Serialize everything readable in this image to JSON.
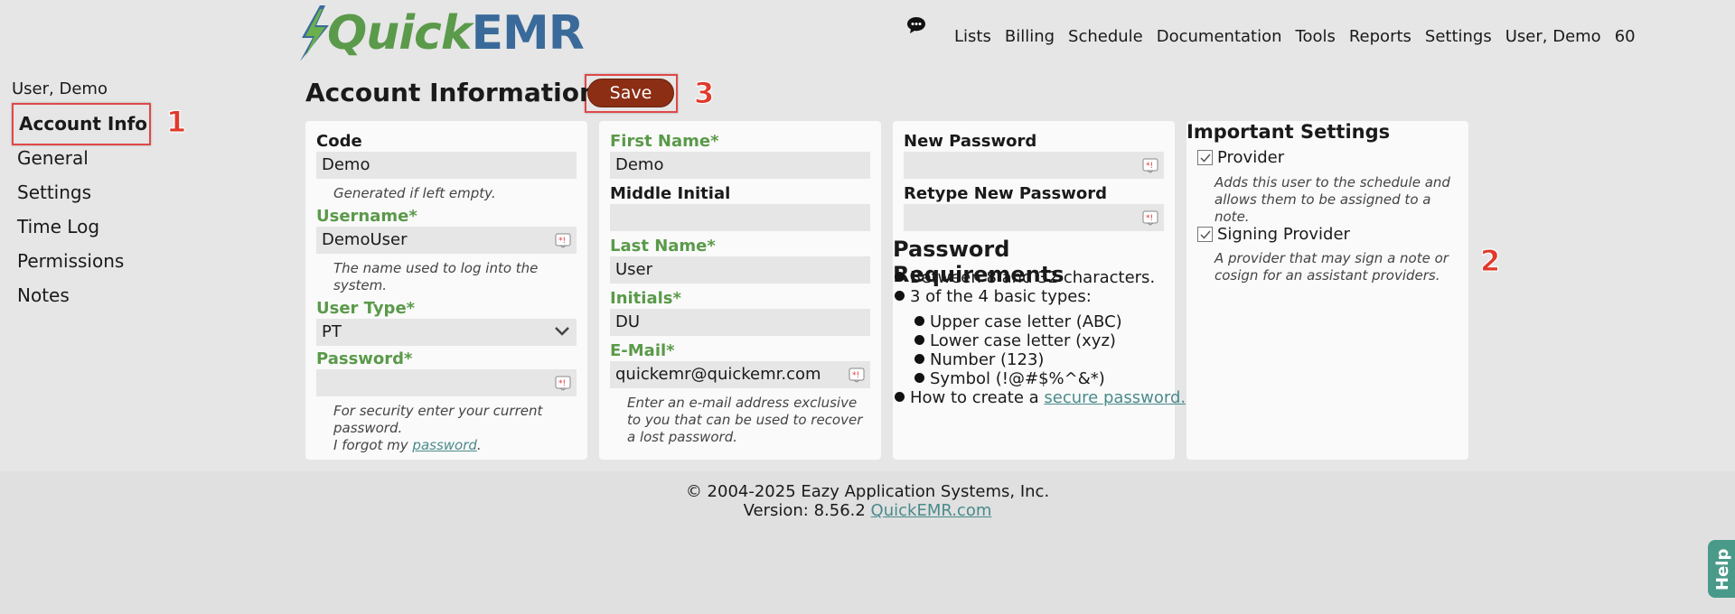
{
  "header": {
    "logo": {
      "quick": "Quick",
      "emr": "EMR"
    },
    "nav": [
      "Lists",
      "Billing",
      "Schedule",
      "Documentation",
      "Tools",
      "Reports",
      "Settings",
      "User, Demo",
      "60"
    ]
  },
  "sidebar": {
    "user": "User, Demo",
    "items": [
      {
        "label": "Account Info",
        "active": true
      },
      {
        "label": "General"
      },
      {
        "label": "Settings"
      },
      {
        "label": "Time Log"
      },
      {
        "label": "Permissions"
      },
      {
        "label": "Notes"
      }
    ]
  },
  "annotations": [
    "1",
    "2",
    "3"
  ],
  "page": {
    "title": "Account Information",
    "save_label": "Save"
  },
  "col1": {
    "code_label": "Code",
    "code_value": "Demo",
    "code_hint": "Generated if left empty.",
    "username_label": "Username*",
    "username_value": "DemoUser",
    "username_hint": "The name used to log into the system.",
    "usertype_label": "User Type*",
    "usertype_value": "PT",
    "password_label": "Password*",
    "password_hint": "For security enter your current password.",
    "forgot_prefix": "I forgot my ",
    "forgot_link": "password",
    "forgot_suffix": "."
  },
  "col2": {
    "first_label": "First Name*",
    "first_value": "Demo",
    "middle_label": "Middle Initial",
    "middle_value": "",
    "last_label": "Last Name*",
    "last_value": "User",
    "initials_label": "Initials*",
    "initials_value": "DU",
    "email_label": "E-Mail*",
    "email_value": "quickemr@quickemr.com",
    "email_hint": "Enter an e-mail address exclusive to you that can be used to recover a lost password."
  },
  "col3": {
    "newpw_label": "New Password",
    "retype_label": "Retype New Password",
    "req_title": "Password Requirements",
    "req_1": "Between 8 and 32 characters.",
    "req_2": "3 of the 4 basic types:",
    "types": [
      "Upper case letter (ABC)",
      "Lower case letter (xyz)",
      "Number (123)",
      "Symbol (!@#$%^&*)"
    ],
    "howto_prefix": "How to create a ",
    "howto_link": "secure password."
  },
  "col4": {
    "title": "Important Settings",
    "provider_label": "Provider",
    "provider_checked": true,
    "provider_hint": "Adds this user to the schedule and allows them to be assigned to a note.",
    "signing_label": "Signing Provider",
    "signing_checked": true,
    "signing_hint": "A provider that may sign a note or cosign for an assistant providers."
  },
  "footer": {
    "copyright": "© 2004-2025 Eazy Application Systems, Inc.",
    "version_prefix": "Version: 8.56.2 ",
    "version_link": "QuickEMR.com"
  },
  "help_label": "Help",
  "colors": {
    "accent": "#8b2e14",
    "green": "#5a9a4a",
    "logo_blue": "#3a6a9a",
    "link": "#4a8a8a",
    "annotation": "#e04848"
  }
}
